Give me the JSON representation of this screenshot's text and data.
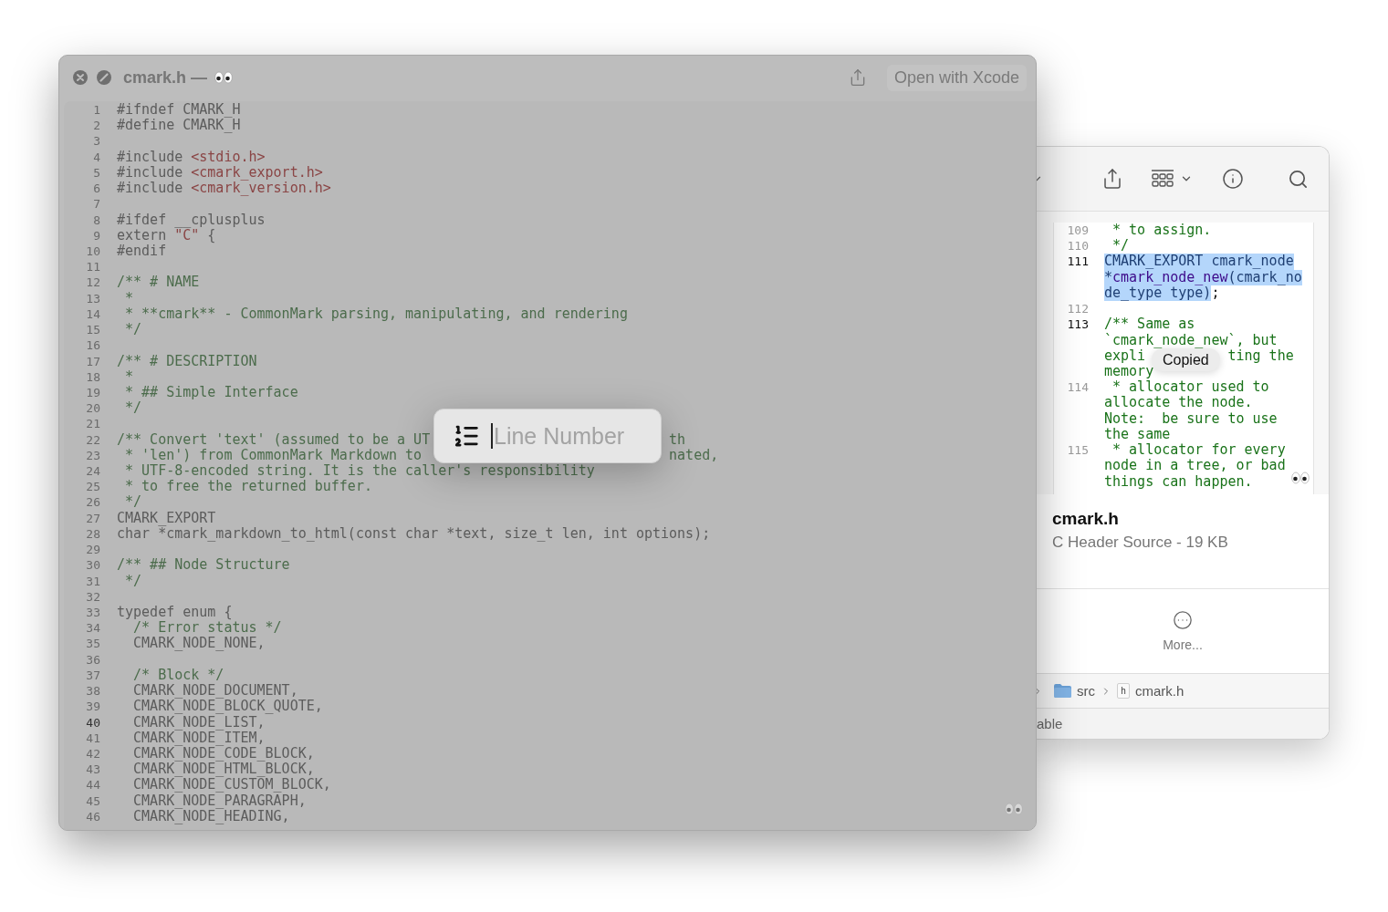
{
  "viewer": {
    "title": "cmark.h —",
    "open_button": "Open with Xcode",
    "lines": [
      {
        "n": "1",
        "current": false,
        "segments": [
          {
            "kind": "plain",
            "text": "#ifndef CMARK_H"
          }
        ]
      },
      {
        "n": "2",
        "current": false,
        "segments": [
          {
            "kind": "plain",
            "text": "#define CMARK_H"
          }
        ]
      },
      {
        "n": "3",
        "current": false
      },
      {
        "n": "4",
        "current": false,
        "segments": [
          {
            "kind": "plain",
            "text": "#include "
          },
          {
            "kind": "string",
            "text": "<stdio.h>"
          }
        ]
      },
      {
        "n": "5",
        "current": false,
        "segments": [
          {
            "kind": "plain",
            "text": "#include "
          },
          {
            "kind": "string",
            "text": "<cmark_export.h>"
          }
        ]
      },
      {
        "n": "6",
        "current": false,
        "segments": [
          {
            "kind": "plain",
            "text": "#include "
          },
          {
            "kind": "string",
            "text": "<cmark_version.h>"
          }
        ]
      },
      {
        "n": "7",
        "current": false
      },
      {
        "n": "8",
        "current": false,
        "segments": [
          {
            "kind": "plain",
            "text": "#ifdef __cplusplus"
          }
        ]
      },
      {
        "n": "9",
        "current": false,
        "segments": [
          {
            "kind": "plain",
            "text": "extern "
          },
          {
            "kind": "string",
            "text": "\"C\""
          },
          {
            "kind": "plain",
            "text": " {"
          }
        ]
      },
      {
        "n": "10",
        "current": false,
        "segments": [
          {
            "kind": "plain",
            "text": "#endif"
          }
        ]
      },
      {
        "n": "11",
        "current": false
      },
      {
        "n": "12",
        "current": false,
        "segments": [
          {
            "kind": "comment",
            "text": "/** # NAME"
          }
        ]
      },
      {
        "n": "13",
        "current": false,
        "segments": [
          {
            "kind": "comment",
            "text": " *"
          }
        ]
      },
      {
        "n": "14",
        "current": false,
        "segments": [
          {
            "kind": "comment",
            "text": " * **cmark** - CommonMark parsing, manipulating, and rendering"
          }
        ]
      },
      {
        "n": "15",
        "current": false,
        "segments": [
          {
            "kind": "comment",
            "text": " */"
          }
        ]
      },
      {
        "n": "16",
        "current": false
      },
      {
        "n": "17",
        "current": false,
        "segments": [
          {
            "kind": "comment",
            "text": "/** # DESCRIPTION"
          }
        ]
      },
      {
        "n": "18",
        "current": false,
        "segments": [
          {
            "kind": "comment",
            "text": " *"
          }
        ]
      },
      {
        "n": "19",
        "current": false,
        "segments": [
          {
            "kind": "comment",
            "text": " * ## Simple Interface"
          }
        ]
      },
      {
        "n": "20",
        "current": false,
        "segments": [
          {
            "kind": "comment",
            "text": " */"
          }
        ]
      },
      {
        "n": "21",
        "current": false
      },
      {
        "n": "22",
        "current": false,
        "segments": [
          {
            "kind": "comment",
            "text": "/** Convert 'text' (assumed to be a UT"
          }
        ],
        "tail": {
          "kind": "comment",
          "text": "th"
        }
      },
      {
        "n": "23",
        "current": false,
        "segments": [
          {
            "kind": "comment",
            "text": " * 'len') from CommonMark Markdown to"
          }
        ],
        "tail": {
          "kind": "comment",
          "text": "nated,"
        }
      },
      {
        "n": "24",
        "current": false,
        "segments": [
          {
            "kind": "comment",
            "text": " * UTF-8-encoded string. It is the caller's responsibility"
          }
        ]
      },
      {
        "n": "25",
        "current": false,
        "segments": [
          {
            "kind": "comment",
            "text": " * to free the returned buffer."
          }
        ]
      },
      {
        "n": "26",
        "current": false,
        "segments": [
          {
            "kind": "comment",
            "text": " */"
          }
        ]
      },
      {
        "n": "27",
        "current": false,
        "segments": [
          {
            "kind": "plain",
            "text": "CMARK_EXPORT"
          }
        ]
      },
      {
        "n": "28",
        "current": false,
        "segments": [
          {
            "kind": "plain",
            "text": "char *cmark_markdown_to_html(const char *text, size_t len, int options);"
          }
        ]
      },
      {
        "n": "29",
        "current": false
      },
      {
        "n": "30",
        "current": false,
        "segments": [
          {
            "kind": "comment",
            "text": "/** ## Node Structure"
          }
        ]
      },
      {
        "n": "31",
        "current": false,
        "segments": [
          {
            "kind": "comment",
            "text": " */"
          }
        ]
      },
      {
        "n": "32",
        "current": false
      },
      {
        "n": "33",
        "current": false,
        "segments": [
          {
            "kind": "plain",
            "text": "typedef enum {"
          }
        ]
      },
      {
        "n": "34",
        "current": false,
        "segments": [
          {
            "kind": "comment",
            "text": "  /* Error status */"
          }
        ]
      },
      {
        "n": "35",
        "current": false,
        "segments": [
          {
            "kind": "plain",
            "text": "  CMARK_NODE_NONE,"
          }
        ]
      },
      {
        "n": "36",
        "current": false
      },
      {
        "n": "37",
        "current": false,
        "segments": [
          {
            "kind": "comment",
            "text": "  /* Block */"
          }
        ]
      },
      {
        "n": "38",
        "current": false,
        "segments": [
          {
            "kind": "plain",
            "text": "  CMARK_NODE_DOCUMENT,"
          }
        ]
      },
      {
        "n": "39",
        "current": false,
        "segments": [
          {
            "kind": "plain",
            "text": "  CMARK_NODE_BLOCK_QUOTE,"
          }
        ]
      },
      {
        "n": "40",
        "current": true,
        "segments": [
          {
            "kind": "plain",
            "text": "  CMARK_NODE_LIST,"
          }
        ]
      },
      {
        "n": "41",
        "current": false,
        "segments": [
          {
            "kind": "plain",
            "text": "  CMARK_NODE_ITEM,"
          }
        ]
      },
      {
        "n": "42",
        "current": false,
        "segments": [
          {
            "kind": "plain",
            "text": "  CMARK_NODE_CODE_BLOCK,"
          }
        ]
      },
      {
        "n": "43",
        "current": false,
        "segments": [
          {
            "kind": "plain",
            "text": "  CMARK_NODE_HTML_BLOCK,"
          }
        ]
      },
      {
        "n": "44",
        "current": false,
        "segments": [
          {
            "kind": "plain",
            "text": "  CMARK_NODE_CUSTOM_BLOCK,"
          }
        ]
      },
      {
        "n": "45",
        "current": false,
        "segments": [
          {
            "kind": "plain",
            "text": "  CMARK_NODE_PARAGRAPH,"
          }
        ]
      },
      {
        "n": "46",
        "current": false,
        "segments": [
          {
            "kind": "plain",
            "text": "  CMARK_NODE_HEADING,"
          }
        ]
      }
    ],
    "goto_popup": {
      "placeholder": "Line Number"
    }
  },
  "finder": {
    "preview_lines": [
      {
        "n": "109",
        "current": false,
        "selected": false,
        "rows": [
          {
            "segments": [
              {
                "kind": "comment",
                "text": " * to assign."
              }
            ]
          }
        ]
      },
      {
        "n": "110",
        "current": false,
        "selected": false,
        "rows": [
          {
            "segments": [
              {
                "kind": "comment",
                "text": " */"
              }
            ]
          }
        ]
      },
      {
        "n": "111",
        "current": true,
        "selected": true,
        "rows": [
          {
            "segments": [
              {
                "kind": "plain",
                "text": "CMARK_EXPORT cmark_node"
              }
            ]
          },
          {
            "segments": [
              {
                "kind": "plain",
                "text": "*"
              },
              {
                "kind": "function",
                "text": "cmark_node_new"
              },
              {
                "kind": "plain",
                "text": "(cmark_no"
              }
            ]
          },
          {
            "segments": [
              {
                "kind": "plain",
                "text": "de_type type)"
              }
            ],
            "after": ";"
          }
        ]
      },
      {
        "n": "112",
        "current": false,
        "selected": false
      },
      {
        "n": "113",
        "current": true,
        "selected": false,
        "rows": [
          {
            "segments": [
              {
                "kind": "comment",
                "text": "/** Same as"
              }
            ]
          },
          {
            "segments": [
              {
                "kind": "comment",
                "text": "`cmark_node_new`, but"
              }
            ]
          },
          {
            "segments": [
              {
                "kind": "comment",
                "text": "expli"
              }
            ],
            "tail": {
              "kind": "comment",
              "text": "ting the"
            }
          },
          {
            "segments": [
              {
                "kind": "comment",
                "text": "memory"
              }
            ]
          }
        ]
      },
      {
        "n": "114",
        "current": false,
        "selected": false,
        "rows": [
          {
            "segments": [
              {
                "kind": "comment",
                "text": " * allocator used to"
              }
            ]
          },
          {
            "segments": [
              {
                "kind": "comment",
                "text": "allocate the node."
              }
            ]
          },
          {
            "segments": [
              {
                "kind": "comment",
                "text": "Note:  be sure to use"
              }
            ]
          },
          {
            "segments": [
              {
                "kind": "comment",
                "text": "the same"
              }
            ]
          }
        ]
      },
      {
        "n": "115",
        "current": false,
        "selected": false,
        "rows": [
          {
            "segments": [
              {
                "kind": "comment",
                "text": " * allocator for every"
              }
            ]
          },
          {
            "segments": [
              {
                "kind": "comment",
                "text": "node in a tree, or bad"
              }
            ]
          },
          {
            "segments": [
              {
                "kind": "comment",
                "text": "things can happen."
              }
            ]
          }
        ]
      }
    ],
    "toast": "Copied",
    "file_name": "cmark.h",
    "file_info": "C Header Source - 19 KB",
    "more_button": "More...",
    "path": [
      {
        "kind": "folder",
        "label": "src"
      },
      {
        "kind": "file",
        "badge": "h",
        "label": "cmark.h"
      }
    ],
    "status": "able"
  }
}
